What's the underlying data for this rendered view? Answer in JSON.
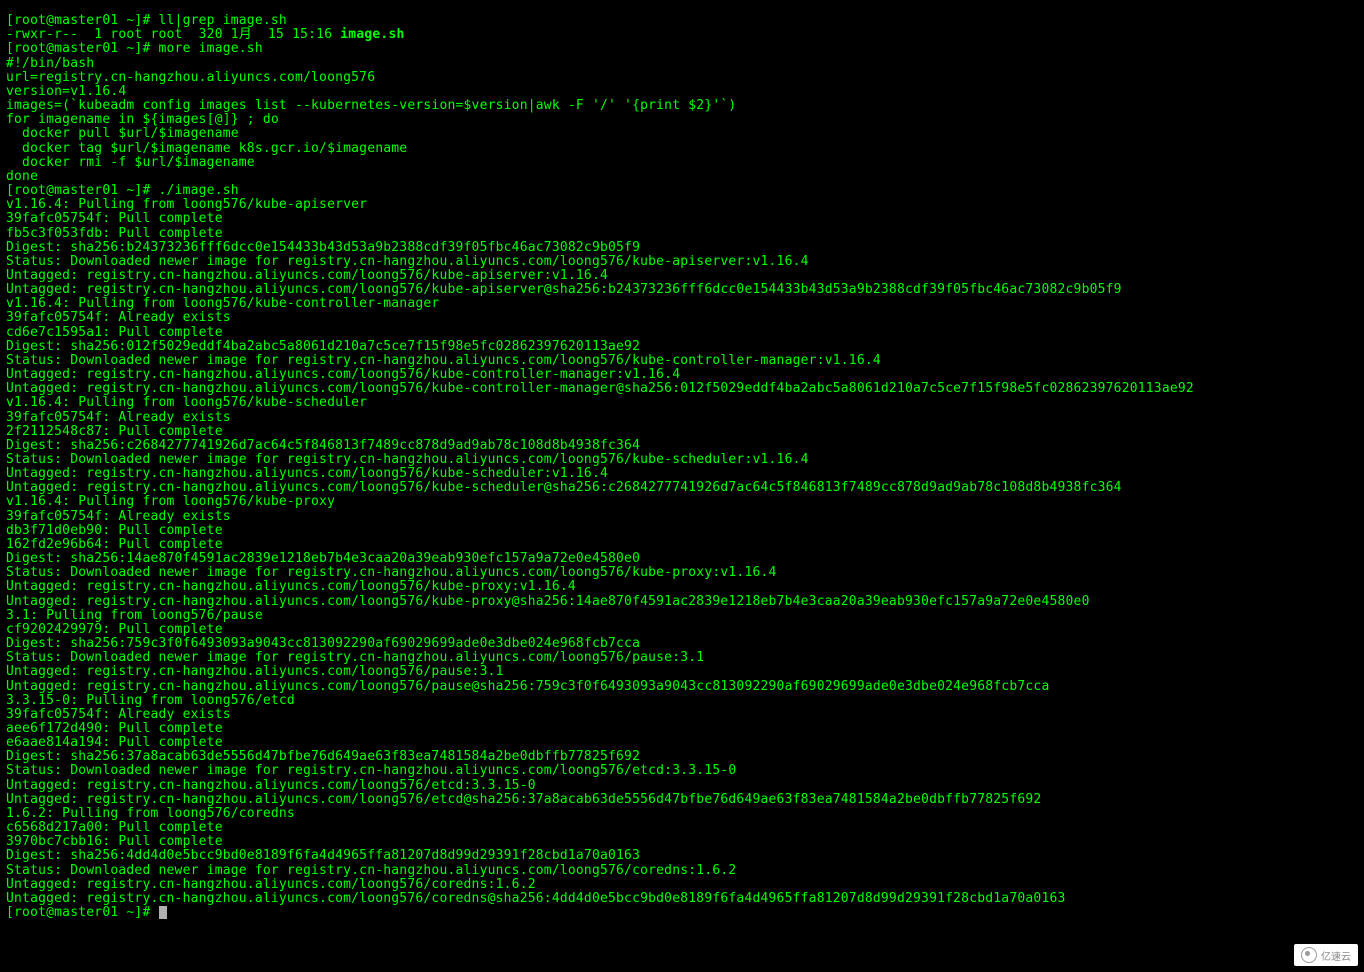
{
  "prompt": "[root@master01 ~]# ",
  "commands": {
    "ll_grep": "ll|grep image.sh",
    "more": "more image.sh",
    "run": "./image.sh"
  },
  "ls_output": {
    "perms": "-rwxr-r--  1 root root  320 1月  15 15:16 ",
    "filename": "image.sh"
  },
  "script": [
    "#!/bin/bash",
    "url=registry.cn-hangzhou.aliyuncs.com/loong576",
    "version=v1.16.4",
    "images=(`kubeadm config images list --kubernetes-version=$version|awk -F '/' '{print $2}'`)",
    "for imagename in ${images[@]} ; do",
    "  docker pull $url/$imagename",
    "  docker tag $url/$imagename k8s.gcr.io/$imagename",
    "  docker rmi -f $url/$imagename",
    "done"
  ],
  "output": [
    "v1.16.4: Pulling from loong576/kube-apiserver",
    "39fafc05754f: Pull complete",
    "fb5c3f053fdb: Pull complete",
    "Digest: sha256:b24373236fff6dcc0e154433b43d53a9b2388cdf39f05fbc46ac73082c9b05f9",
    "Status: Downloaded newer image for registry.cn-hangzhou.aliyuncs.com/loong576/kube-apiserver:v1.16.4",
    "Untagged: registry.cn-hangzhou.aliyuncs.com/loong576/kube-apiserver:v1.16.4",
    "Untagged: registry.cn-hangzhou.aliyuncs.com/loong576/kube-apiserver@sha256:b24373236fff6dcc0e154433b43d53a9b2388cdf39f05fbc46ac73082c9b05f9",
    "v1.16.4: Pulling from loong576/kube-controller-manager",
    "39fafc05754f: Already exists",
    "cd6e7c1595a1: Pull complete",
    "Digest: sha256:012f5029eddf4ba2abc5a8061d210a7c5ce7f15f98e5fc02862397620113ae92",
    "Status: Downloaded newer image for registry.cn-hangzhou.aliyuncs.com/loong576/kube-controller-manager:v1.16.4",
    "Untagged: registry.cn-hangzhou.aliyuncs.com/loong576/kube-controller-manager:v1.16.4",
    "Untagged: registry.cn-hangzhou.aliyuncs.com/loong576/kube-controller-manager@sha256:012f5029eddf4ba2abc5a8061d210a7c5ce7f15f98e5fc02862397620113ae92",
    "v1.16.4: Pulling from loong576/kube-scheduler",
    "39fafc05754f: Already exists",
    "2f2112548c87: Pull complete",
    "Digest: sha256:c2684277741926d7ac64c5f846813f7489cc878d9ad9ab78c108d8b4938fc364",
    "Status: Downloaded newer image for registry.cn-hangzhou.aliyuncs.com/loong576/kube-scheduler:v1.16.4",
    "Untagged: registry.cn-hangzhou.aliyuncs.com/loong576/kube-scheduler:v1.16.4",
    "Untagged: registry.cn-hangzhou.aliyuncs.com/loong576/kube-scheduler@sha256:c2684277741926d7ac64c5f846813f7489cc878d9ad9ab78c108d8b4938fc364",
    "v1.16.4: Pulling from loong576/kube-proxy",
    "39fafc05754f: Already exists",
    "db3f71d0eb90: Pull complete",
    "162fd2e96b64: Pull complete",
    "Digest: sha256:14ae870f4591ac2839e1218eb7b4e3caa20a39eab930efc157a9a72e0e4580e0",
    "Status: Downloaded newer image for registry.cn-hangzhou.aliyuncs.com/loong576/kube-proxy:v1.16.4",
    "Untagged: registry.cn-hangzhou.aliyuncs.com/loong576/kube-proxy:v1.16.4",
    "Untagged: registry.cn-hangzhou.aliyuncs.com/loong576/kube-proxy@sha256:14ae870f4591ac2839e1218eb7b4e3caa20a39eab930efc157a9a72e0e4580e0",
    "3.1: Pulling from loong576/pause",
    "cf9202429979: Pull complete",
    "Digest: sha256:759c3f0f6493093a9043cc813092290af69029699ade0e3dbe024e968fcb7cca",
    "Status: Downloaded newer image for registry.cn-hangzhou.aliyuncs.com/loong576/pause:3.1",
    "Untagged: registry.cn-hangzhou.aliyuncs.com/loong576/pause:3.1",
    "Untagged: registry.cn-hangzhou.aliyuncs.com/loong576/pause@sha256:759c3f0f6493093a9043cc813092290af69029699ade0e3dbe024e968fcb7cca",
    "3.3.15-0: Pulling from loong576/etcd",
    "39fafc05754f: Already exists",
    "aee6f172d490: Pull complete",
    "e6aae814a194: Pull complete",
    "Digest: sha256:37a8acab63de5556d47bfbe76d649ae63f83ea7481584a2be0dbffb77825f692",
    "Status: Downloaded newer image for registry.cn-hangzhou.aliyuncs.com/loong576/etcd:3.3.15-0",
    "Untagged: registry.cn-hangzhou.aliyuncs.com/loong576/etcd:3.3.15-0",
    "Untagged: registry.cn-hangzhou.aliyuncs.com/loong576/etcd@sha256:37a8acab63de5556d47bfbe76d649ae63f83ea7481584a2be0dbffb77825f692",
    "1.6.2: Pulling from loong576/coredns",
    "c6568d217a00: Pull complete",
    "3970bc7cbb16: Pull complete",
    "Digest: sha256:4dd4d0e5bcc9bd0e8189f6fa4d4965ffa81207d8d99d29391f28cbd1a70a0163",
    "Status: Downloaded newer image for registry.cn-hangzhou.aliyuncs.com/loong576/coredns:1.6.2",
    "Untagged: registry.cn-hangzhou.aliyuncs.com/loong576/coredns:1.6.2",
    "Untagged: registry.cn-hangzhou.aliyuncs.com/loong576/coredns@sha256:4dd4d0e5bcc9bd0e8189f6fa4d4965ffa81207d8d99d29391f28cbd1a70a0163"
  ],
  "watermark": "亿速云"
}
